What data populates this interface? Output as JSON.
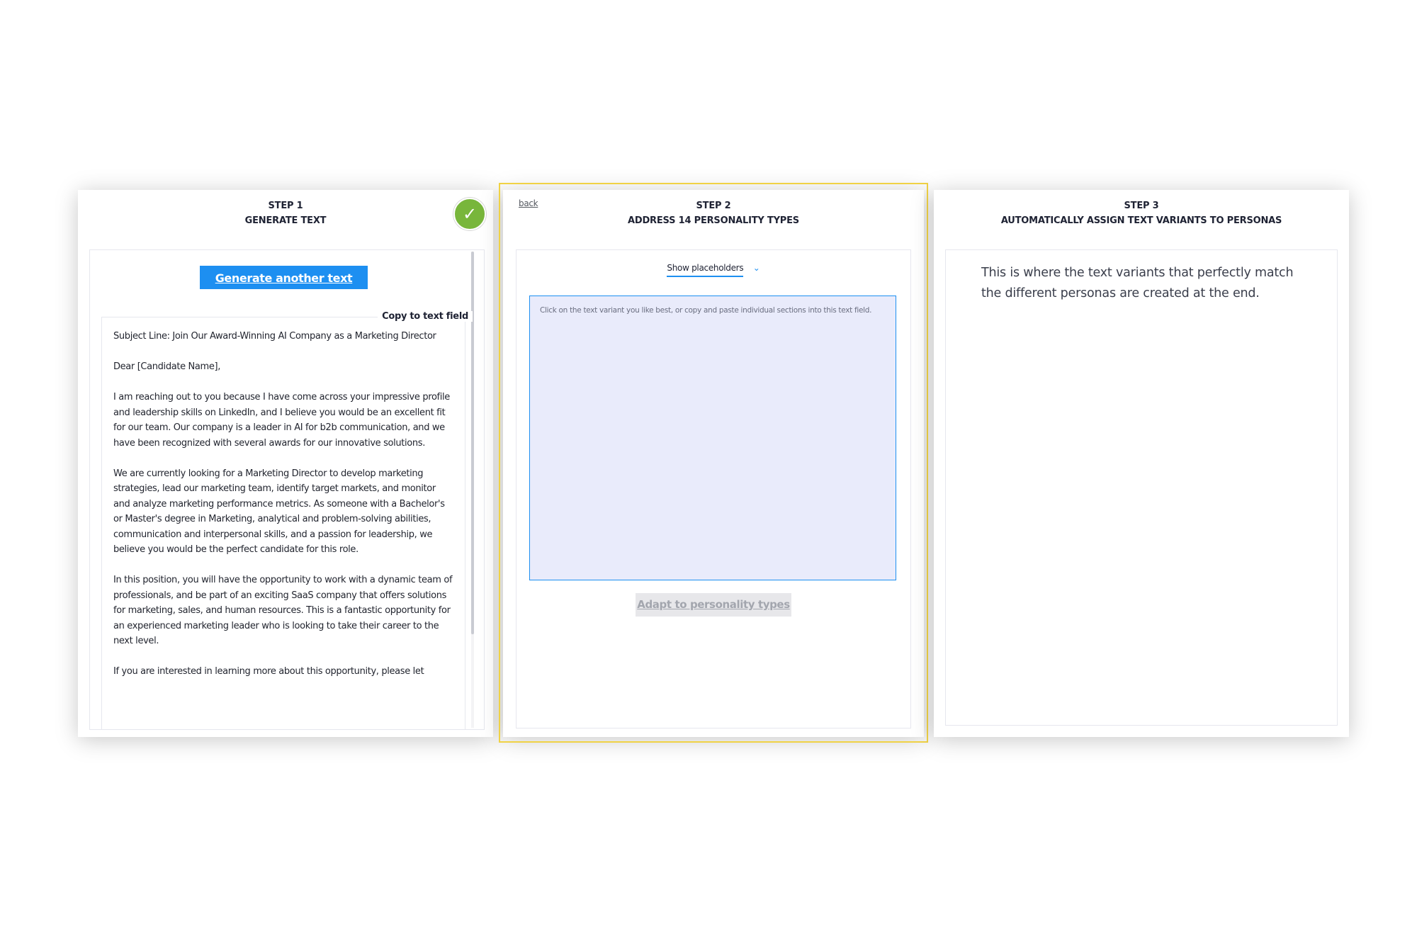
{
  "step1": {
    "step_label": "STEP 1",
    "title": "GENERATE TEXT",
    "check_glyph": "✓",
    "generate_button": "Generate another text",
    "copy_link": "Copy to text field",
    "letter": "Subject Line: Join Our Award-Winning AI Company as a Marketing Director\n\nDear [Candidate Name],\n\nI am reaching out to you because I have come across your impressive profile and leadership skills on LinkedIn, and I believe you would be an excellent fit for our team. Our company is a leader in AI for b2b communication, and we have been recognized with several awards for our innovative solutions.\n\nWe are currently looking for a Marketing Director to develop marketing strategies, lead our marketing team, identify target markets, and monitor and analyze marketing performance metrics. As someone with a Bachelor's or Master's degree in Marketing, analytical and problem-solving abilities, communication and interpersonal skills, and a passion for leadership, we believe you would be the perfect candidate for this role.\n\nIn this position, you will have the opportunity to work with a dynamic team of professionals, and be part of an exciting SaaS company that offers solutions for marketing, sales, and human resources. This is a fantastic opportunity for an experienced marketing leader who is looking to take their career to the next level.\n\nIf you are interested in learning more about this opportunity, please let"
  },
  "step2": {
    "back_link": "back",
    "step_label": "STEP 2",
    "title": "ADDRESS 14 PERSONALITY TYPES",
    "toggle_label": "Show placeholders",
    "toggle_chevron": "⌄",
    "textarea_placeholder": "Click on the text variant you like best, or copy and paste individual sections into this text field.",
    "adapt_button": "Adapt to personality types"
  },
  "step3": {
    "step_label": "STEP 3",
    "title": "AUTOMATICALLY ASSIGN TEXT VARIANTS TO PERSONAS",
    "description": "This is where the text variants that perfectly match the different personas are created at the end."
  },
  "colors": {
    "accent": "#1d8ff1",
    "success": "#78b63b",
    "highlight": "#f0d245",
    "textarea_bg": "#e9ebfb"
  }
}
